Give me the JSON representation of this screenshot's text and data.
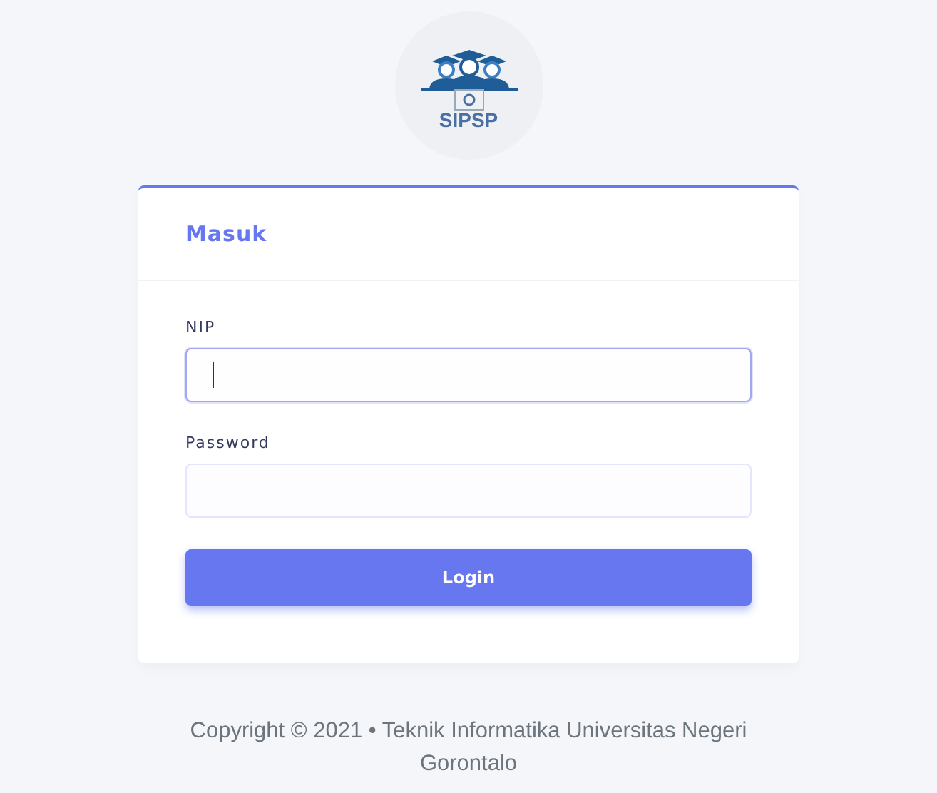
{
  "logo": {
    "text": "SIPSP"
  },
  "card": {
    "title": "Masuk",
    "fields": [
      {
        "label": "NIP",
        "focused": true
      },
      {
        "label": "Password",
        "focused": false
      }
    ],
    "button": "Login"
  },
  "footer": {
    "text": "Copyright © 2021",
    "separator": "•",
    "org": "Teknik Informatika Universitas Negeri Gorontalo"
  }
}
